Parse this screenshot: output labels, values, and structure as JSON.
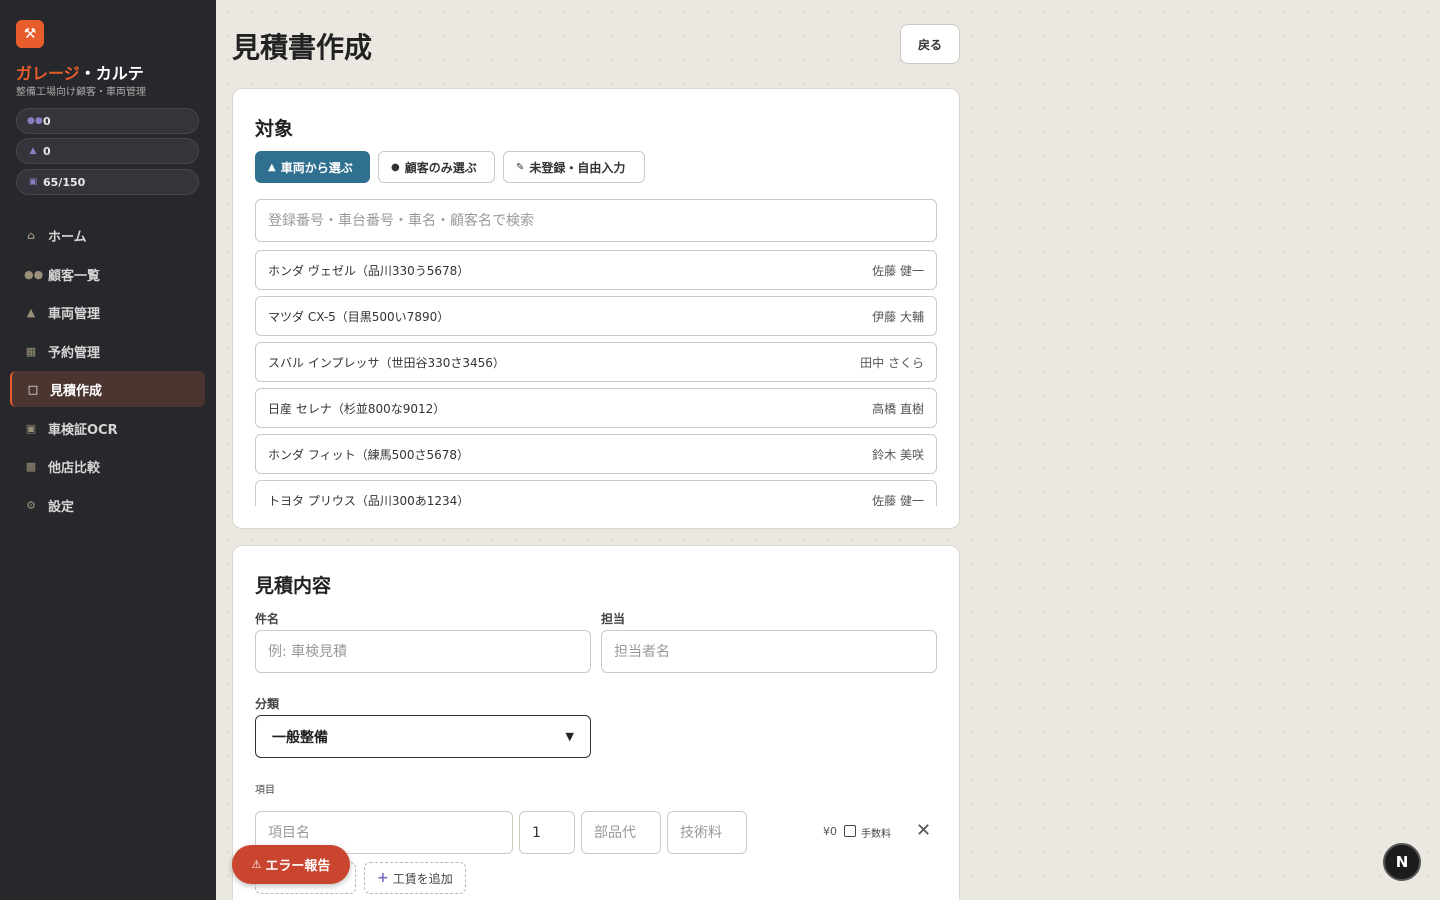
{
  "sidebar": {
    "brand_accent": "ガレージ",
    "brand_rest": "・カルテ",
    "subtitle": "整備工場向け顧客・車両管理",
    "stats": [
      {
        "icon": "users-icon",
        "value": "0"
      },
      {
        "icon": "car-icon",
        "value": "0"
      },
      {
        "icon": "card-icon",
        "value": "65/150"
      }
    ],
    "nav": [
      {
        "label": "ホーム",
        "icon": "home-icon"
      },
      {
        "label": "顧客一覧",
        "icon": "users-icon"
      },
      {
        "label": "車両管理",
        "icon": "car-icon"
      },
      {
        "label": "予約管理",
        "icon": "calendar-icon"
      },
      {
        "label": "見積作成",
        "icon": "document-icon",
        "active": true
      },
      {
        "label": "車検証OCR",
        "icon": "card-icon"
      },
      {
        "label": "他店比較",
        "icon": "chart-icon"
      },
      {
        "label": "設定",
        "icon": "gear-icon"
      }
    ]
  },
  "header": {
    "title": "見積書作成",
    "back_label": "戻る"
  },
  "target": {
    "title": "対象",
    "tabs": [
      {
        "label": "車両から選ぶ",
        "icon": "car-icon",
        "active": true
      },
      {
        "label": "顧客のみ選ぶ",
        "icon": "person-icon"
      },
      {
        "label": "未登録・自由入力",
        "icon": "note-icon"
      }
    ],
    "search_placeholder": "登録番号・車台番号・車名・顧客名で検索",
    "vehicles": [
      {
        "name": "ホンダ ヴェゼル（品川330う5678）",
        "owner": "佐藤 健一"
      },
      {
        "name": "マツダ CX-5（目黒500い7890）",
        "owner": "伊藤 大輔"
      },
      {
        "name": "スバル インプレッサ（世田谷330さ3456）",
        "owner": "田中 さくら"
      },
      {
        "name": "日産 セレナ（杉並800な9012）",
        "owner": "高橋 直樹"
      },
      {
        "name": "ホンダ フィット（練馬500さ5678）",
        "owner": "鈴木 美咲"
      },
      {
        "name": "トヨタ プリウス（品川300あ1234）",
        "owner": "佐藤 健一"
      }
    ]
  },
  "estimate": {
    "title": "見積内容",
    "subject_label": "件名",
    "subject_placeholder": "例: 車検見積",
    "staff_label": "担当",
    "staff_placeholder": "担当者名",
    "category_label": "分類",
    "category_value": "一般整備",
    "items_label": "項目",
    "item": {
      "name_placeholder": "項目名",
      "qty": "1",
      "parts_placeholder": "部品代",
      "labor_placeholder": "技術料",
      "amount": "¥0",
      "fee_label": "手数料"
    },
    "add_labor_label": "工賃を追加"
  },
  "floating": {
    "error_report_label": "エラー報告",
    "next_badge": "N"
  },
  "colors": {
    "accent": "#e85d2c",
    "primary": "#2f6f8f",
    "sidebar_bg": "#27282c",
    "error": "#c9452f"
  }
}
